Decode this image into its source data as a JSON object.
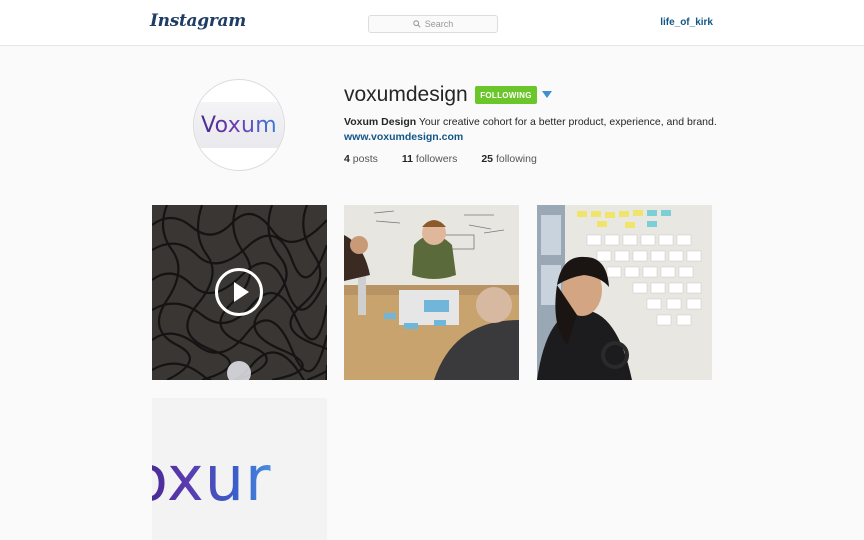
{
  "nav": {
    "logo_text": "Instagram",
    "search_placeholder": "Search",
    "current_user": "life_of_kirk"
  },
  "profile": {
    "avatar_wordmark": "Voxum",
    "username": "voxumdesign",
    "follow_state_label": "FOLLOWING",
    "full_name": "Voxum Design",
    "bio": "Your creative cohort for a better product, experience, and brand.",
    "website": "www.voxumdesign.com",
    "stats": {
      "posts_count": "4",
      "posts_label": "posts",
      "followers_count": "11",
      "followers_label": "followers",
      "following_count": "25",
      "following_label": "following"
    }
  },
  "posts": [
    {
      "kind": "video",
      "icon": "play-icon"
    },
    {
      "kind": "photo"
    },
    {
      "kind": "photo"
    },
    {
      "kind": "photo",
      "wordmark": "oxur"
    }
  ],
  "colors": {
    "following_button": "#6bc62b",
    "link": "#125688",
    "caret": "#3f8fd2"
  }
}
